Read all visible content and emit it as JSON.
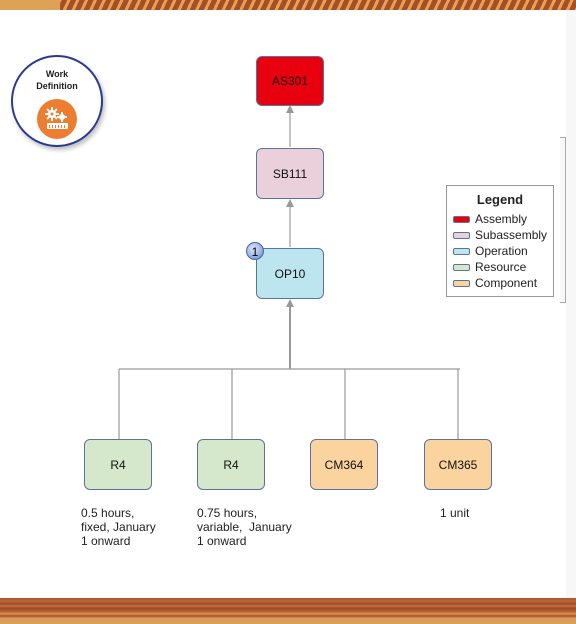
{
  "badge": {
    "title_line1": "Work",
    "title_line2": "Definition",
    "icon": "gears-ruler-icon"
  },
  "nodes": {
    "assembly": {
      "label": "AS301",
      "type": "Assembly"
    },
    "subassembly": {
      "label": "SB111",
      "type": "Subassembly"
    },
    "operation": {
      "label": "OP10",
      "type": "Operation",
      "step_number": "1"
    },
    "children": [
      {
        "label": "R4",
        "type": "Resource",
        "note": "0.5 hours,\nfixed, January\n1 onward"
      },
      {
        "label": "R4",
        "type": "Resource",
        "note": "0.75 hours,\nvariable,  January\n1 onward"
      },
      {
        "label": "CM364",
        "type": "Component",
        "note": ""
      },
      {
        "label": "CM365",
        "type": "Component",
        "note": "1 unit"
      }
    ]
  },
  "legend": {
    "title": "Legend",
    "items": [
      {
        "label": "Assembly",
        "color": "#e8000e"
      },
      {
        "label": "Subassembly",
        "color": "#ead0da"
      },
      {
        "label": "Operation",
        "color": "#bde5ef"
      },
      {
        "label": "Resource",
        "color": "#d5e8cc"
      },
      {
        "label": "Component",
        "color": "#fbd39e"
      }
    ]
  },
  "colors": {
    "node_border": "#5a7599",
    "connector": "#999999",
    "badge_ring": "#2a3a8c",
    "badge_icon_bg": "#ed7d31"
  }
}
